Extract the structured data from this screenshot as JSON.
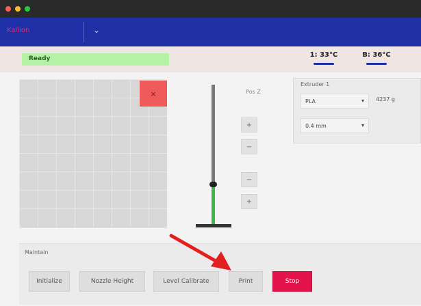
{
  "window": {
    "controls": [
      "close",
      "minimize",
      "zoom"
    ]
  },
  "appbar": {
    "logo": "Kallion",
    "menu_icon": "chevron-down-icon"
  },
  "status": {
    "state": "Ready",
    "temp1": "1: 33°C",
    "temp_bed": "B: 36°C"
  },
  "jog": {
    "close_glyph": "×",
    "axis_label": "Pos Z",
    "z_buttons": [
      "+",
      "−",
      "−",
      "+"
    ],
    "z_level_fraction": 0.29
  },
  "extruder": {
    "title": "Extruder 1",
    "material": "PLA",
    "weight": "4237 g",
    "nozzle": "0.4 mm"
  },
  "maintenance": {
    "title": "Maintain",
    "buttons": [
      "Initialize",
      "Nozzle Height",
      "Level Calibrate",
      "Print",
      "Stop"
    ]
  },
  "colors": {
    "appbar": "#1f2fa6",
    "ready": "#b4f2a6",
    "stop": "#e3134b",
    "jog_close": "#ef5a5a",
    "z_fill": "#3fb648",
    "annotation_arrow": "#e32020"
  }
}
